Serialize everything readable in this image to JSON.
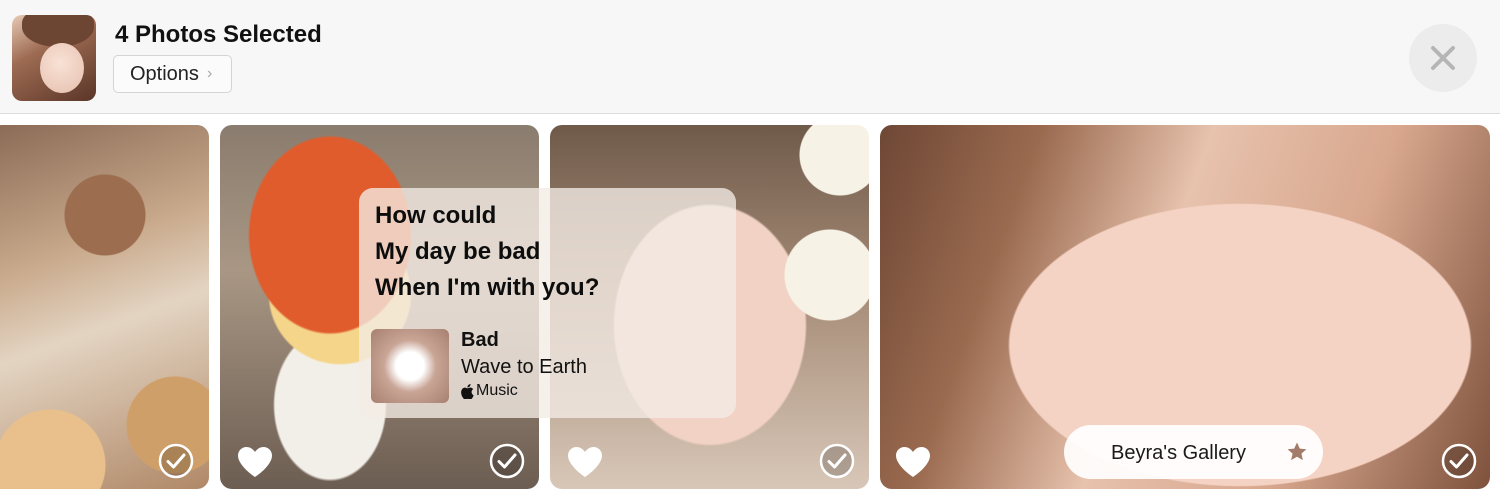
{
  "header": {
    "title": "4 Photos Selected",
    "options_label": "Options",
    "avatar": "profile-photo",
    "close_icon": "close-icon"
  },
  "photos": [
    {
      "id": "photo-1",
      "subject": "bread-pastries",
      "favorited": false,
      "selected": true
    },
    {
      "id": "photo-2",
      "subject": "figure-with-noodles",
      "favorited": false,
      "selected": true
    },
    {
      "id": "photo-3",
      "subject": "nail-art",
      "favorited": false,
      "selected": true
    },
    {
      "id": "photo-4",
      "subject": "portrait",
      "favorited": false,
      "selected": true
    }
  ],
  "lyrics_card": {
    "lines": [
      "How could",
      "My day be bad",
      "When I'm with you?"
    ],
    "song_title": "Bad",
    "artist": "Wave to Earth",
    "service": "Music",
    "service_icon": "apple-icon"
  },
  "gallery_chip": {
    "label": "Beyra's Gallery",
    "icon": "star-icon"
  },
  "colors": {
    "header_bg": "#f7f7f7",
    "star": "#a27b6a",
    "check_ring": "#ffffff"
  }
}
